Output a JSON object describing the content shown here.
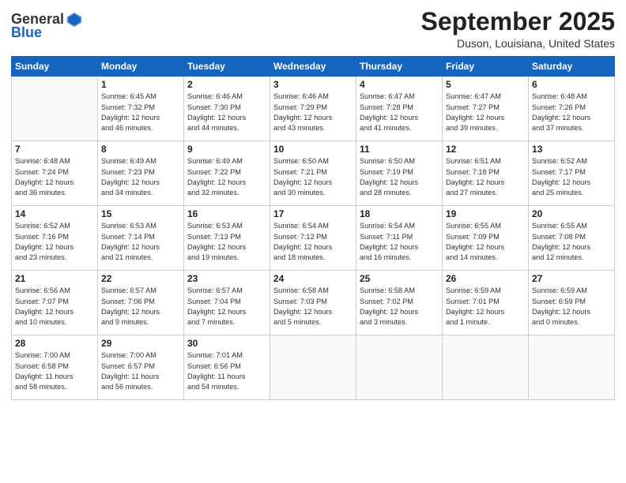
{
  "header": {
    "logo_general": "General",
    "logo_blue": "Blue",
    "month_title": "September 2025",
    "location": "Duson, Louisiana, United States"
  },
  "days_of_week": [
    "Sunday",
    "Monday",
    "Tuesday",
    "Wednesday",
    "Thursday",
    "Friday",
    "Saturday"
  ],
  "weeks": [
    [
      {
        "num": "",
        "info": ""
      },
      {
        "num": "1",
        "info": "Sunrise: 6:45 AM\nSunset: 7:32 PM\nDaylight: 12 hours\nand 46 minutes."
      },
      {
        "num": "2",
        "info": "Sunrise: 6:46 AM\nSunset: 7:30 PM\nDaylight: 12 hours\nand 44 minutes."
      },
      {
        "num": "3",
        "info": "Sunrise: 6:46 AM\nSunset: 7:29 PM\nDaylight: 12 hours\nand 43 minutes."
      },
      {
        "num": "4",
        "info": "Sunrise: 6:47 AM\nSunset: 7:28 PM\nDaylight: 12 hours\nand 41 minutes."
      },
      {
        "num": "5",
        "info": "Sunrise: 6:47 AM\nSunset: 7:27 PM\nDaylight: 12 hours\nand 39 minutes."
      },
      {
        "num": "6",
        "info": "Sunrise: 6:48 AM\nSunset: 7:26 PM\nDaylight: 12 hours\nand 37 minutes."
      }
    ],
    [
      {
        "num": "7",
        "info": "Sunrise: 6:48 AM\nSunset: 7:24 PM\nDaylight: 12 hours\nand 36 minutes."
      },
      {
        "num": "8",
        "info": "Sunrise: 6:49 AM\nSunset: 7:23 PM\nDaylight: 12 hours\nand 34 minutes."
      },
      {
        "num": "9",
        "info": "Sunrise: 6:49 AM\nSunset: 7:22 PM\nDaylight: 12 hours\nand 32 minutes."
      },
      {
        "num": "10",
        "info": "Sunrise: 6:50 AM\nSunset: 7:21 PM\nDaylight: 12 hours\nand 30 minutes."
      },
      {
        "num": "11",
        "info": "Sunrise: 6:50 AM\nSunset: 7:19 PM\nDaylight: 12 hours\nand 28 minutes."
      },
      {
        "num": "12",
        "info": "Sunrise: 6:51 AM\nSunset: 7:18 PM\nDaylight: 12 hours\nand 27 minutes."
      },
      {
        "num": "13",
        "info": "Sunrise: 6:52 AM\nSunset: 7:17 PM\nDaylight: 12 hours\nand 25 minutes."
      }
    ],
    [
      {
        "num": "14",
        "info": "Sunrise: 6:52 AM\nSunset: 7:16 PM\nDaylight: 12 hours\nand 23 minutes."
      },
      {
        "num": "15",
        "info": "Sunrise: 6:53 AM\nSunset: 7:14 PM\nDaylight: 12 hours\nand 21 minutes."
      },
      {
        "num": "16",
        "info": "Sunrise: 6:53 AM\nSunset: 7:13 PM\nDaylight: 12 hours\nand 19 minutes."
      },
      {
        "num": "17",
        "info": "Sunrise: 6:54 AM\nSunset: 7:12 PM\nDaylight: 12 hours\nand 18 minutes."
      },
      {
        "num": "18",
        "info": "Sunrise: 6:54 AM\nSunset: 7:11 PM\nDaylight: 12 hours\nand 16 minutes."
      },
      {
        "num": "19",
        "info": "Sunrise: 6:55 AM\nSunset: 7:09 PM\nDaylight: 12 hours\nand 14 minutes."
      },
      {
        "num": "20",
        "info": "Sunrise: 6:55 AM\nSunset: 7:08 PM\nDaylight: 12 hours\nand 12 minutes."
      }
    ],
    [
      {
        "num": "21",
        "info": "Sunrise: 6:56 AM\nSunset: 7:07 PM\nDaylight: 12 hours\nand 10 minutes."
      },
      {
        "num": "22",
        "info": "Sunrise: 6:57 AM\nSunset: 7:06 PM\nDaylight: 12 hours\nand 9 minutes."
      },
      {
        "num": "23",
        "info": "Sunrise: 6:57 AM\nSunset: 7:04 PM\nDaylight: 12 hours\nand 7 minutes."
      },
      {
        "num": "24",
        "info": "Sunrise: 6:58 AM\nSunset: 7:03 PM\nDaylight: 12 hours\nand 5 minutes."
      },
      {
        "num": "25",
        "info": "Sunrise: 6:58 AM\nSunset: 7:02 PM\nDaylight: 12 hours\nand 3 minutes."
      },
      {
        "num": "26",
        "info": "Sunrise: 6:59 AM\nSunset: 7:01 PM\nDaylight: 12 hours\nand 1 minute."
      },
      {
        "num": "27",
        "info": "Sunrise: 6:59 AM\nSunset: 6:59 PM\nDaylight: 12 hours\nand 0 minutes."
      }
    ],
    [
      {
        "num": "28",
        "info": "Sunrise: 7:00 AM\nSunset: 6:58 PM\nDaylight: 11 hours\nand 58 minutes."
      },
      {
        "num": "29",
        "info": "Sunrise: 7:00 AM\nSunset: 6:57 PM\nDaylight: 11 hours\nand 56 minutes."
      },
      {
        "num": "30",
        "info": "Sunrise: 7:01 AM\nSunset: 6:56 PM\nDaylight: 11 hours\nand 54 minutes."
      },
      {
        "num": "",
        "info": ""
      },
      {
        "num": "",
        "info": ""
      },
      {
        "num": "",
        "info": ""
      },
      {
        "num": "",
        "info": ""
      }
    ]
  ]
}
